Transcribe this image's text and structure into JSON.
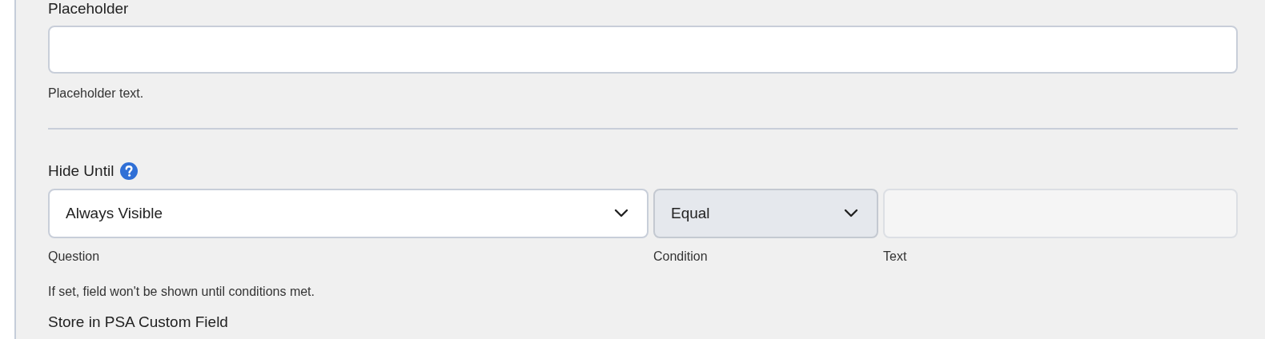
{
  "placeholder_field": {
    "label": "Placeholder",
    "help": "Placeholder text."
  },
  "hide_until": {
    "label": "Hide Until",
    "help": "If set, field won't be shown until conditions met.",
    "controls": [
      {
        "kind": "select",
        "value": "Always Visible",
        "caption": "Question",
        "disabled": false
      },
      {
        "kind": "select",
        "value": "Equal",
        "caption": "Condition",
        "disabled": true
      },
      {
        "kind": "text",
        "caption": "Text",
        "disabled": true
      }
    ]
  },
  "next_label": "Store in PSA Custom Field"
}
